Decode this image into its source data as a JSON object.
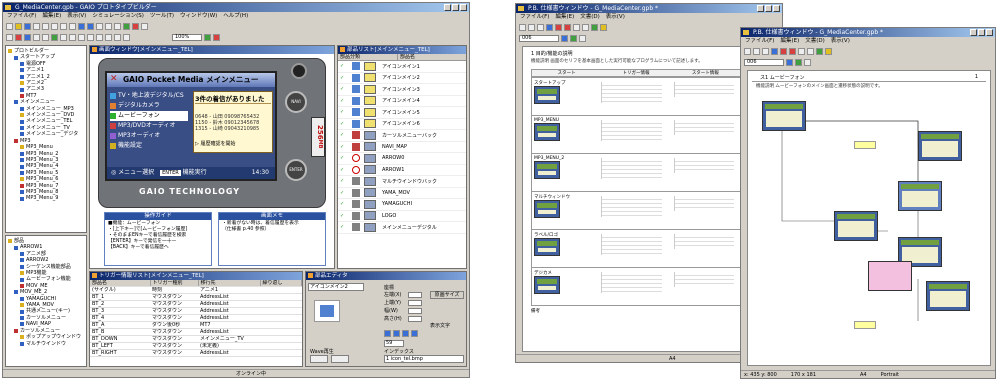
{
  "left_window": {
    "title": "G_MediaCenter.gpb - GAIO プロトタイプビルダー",
    "menu": [
      "ファイル(F)",
      "編集(E)",
      "表示(V)",
      "シミュレーション(S)",
      "ツール(T)",
      "ウィンドウ(W)",
      "ヘルプ(H)"
    ],
    "zoom": "100%",
    "status": "オンライン中",
    "tree_top": {
      "title": "プロトビルダー",
      "items": [
        "プロトビルダー",
        "スタートアップ",
        "電源OFF",
        "アニメ1",
        "アニメ1_2",
        "アニメ2",
        "アニメ3",
        "MT7",
        "メインメニュー",
        "メインメニュー_MP3",
        "メインメニュー_DVD",
        "メインメニュー_TEL",
        "メインメニュー_TV",
        "メインメニュー_デジタ",
        "MP3",
        "MP3_Menu",
        "MP3_Menu_2",
        "MP3_Menu_3",
        "MP3_Menu_4",
        "MP3_Menu_5",
        "MP3_Menu_6",
        "MP3_Menu_7",
        "MP3_Menu_8",
        "MP3_Menu_9"
      ]
    },
    "tree_bottom": {
      "title": "プロトビルダー",
      "items": [
        "部品",
        "ARROW1",
        "アニメ部",
        "ARROW2",
        "シーケンス機能部品",
        "MP3機能",
        "ムービーフォン機能",
        "MOV_ME",
        "MOV_ME_2",
        "YAMAGUCHI",
        "YAMA_MOV",
        "共通メニュー(キー)",
        "カーソルメニュー",
        "NAVI_MAP",
        "カーソルメニュー",
        "ポップアップウインドウ",
        "マルチウインドウ"
      ]
    },
    "screen_window": {
      "title": "画面ウィンドウ[メインメニュー_TEL]",
      "banner": "GAIO Pocket Media メインメニュー",
      "menu_items": [
        "TV・地上波デジタル/CS",
        "デジタルカメラ",
        "ムービーフォン",
        "MP3/DVDオーディオ",
        "MP3オーディオ",
        "機能設定"
      ],
      "history_title": "3件の着信がありました",
      "history": [
        "0648 - 山田 09098765432",
        "1150 - 鈴木 09012345678",
        "1315 - 山崎 09043210985"
      ],
      "history_link": "履歴確認を開始",
      "footer_left": "メニュー選択",
      "footer_enter": "ENTER",
      "footer_mid": "機能実行",
      "time": "14:30",
      "brand": "GAIO TECHNOLOGY",
      "side_label": "256",
      "side_unit": "MB",
      "guide_title": "操作ガイド",
      "guide_lines": [
        "■機能：ムービーフォン",
        "・[上下キー]で[ムービーフォン履歴]",
        "・そのままENキーで着信履歴を検索",
        "【ENTER】キーで発信を一十ー",
        "【BACK】キーで着信履歴へ"
      ],
      "note_title": "画面メモ",
      "note_lines": [
        "・新着がない時は、着信履歴を表示",
        "（仕様書 p.40 参照）"
      ]
    },
    "parts_list": {
      "title": "部品リスト[メインメニュー_TEL]",
      "headers": [
        "部品分類",
        "部品名"
      ],
      "rows": [
        "アイコンメイン1",
        "アイコンメイン2",
        "アイコンメイン3",
        "アイコンメイン4",
        "アイコンメイン5",
        "アイコンメイン6",
        "カーソルメニューバック",
        "NAVI_MAP",
        "ARROW0",
        "ARROW1",
        "マルチウインドウバック",
        "YAMA_MOV",
        "YAMAGUCHI",
        "LOGO",
        "メインメニューデジタル"
      ]
    },
    "trigger_list": {
      "title": "トリガー情報リスト[メインメニュー_TEL]",
      "headers": [
        "部品名",
        "トリガー種別",
        "移行先",
        "繰り返し"
      ],
      "rows": [
        [
          "(サイクル)",
          "時刻",
          "アニメ1",
          ""
        ],
        [
          "BT_1",
          "マウスダウン",
          "AddressList",
          ""
        ],
        [
          "BT_2",
          "マウスダウン",
          "AddressList",
          ""
        ],
        [
          "BT_3",
          "マウスダウン",
          "AddressList",
          ""
        ],
        [
          "BT_4",
          "マウスダウン",
          "AddressList",
          ""
        ],
        [
          "BT_A",
          "ダウン後0秒",
          "MT7",
          ""
        ],
        [
          "BT_B",
          "マウスダウン",
          "AddressList",
          ""
        ],
        [
          "BT_DOWN",
          "マウスダウン",
          "メインメニュー_TV",
          ""
        ],
        [
          "BT_LEFT",
          "マウスダウン",
          "(未定義)",
          ""
        ],
        [
          "BT_RIGHT",
          "マウスダウン",
          "AddressList",
          ""
        ]
      ]
    },
    "parts_editor": {
      "title": "部品エディタ",
      "field_label": "アイコンメイン2",
      "size_label": "座標",
      "labels": [
        "左端(X)",
        "上端(Y)",
        "幅(W)",
        "高さ(H)"
      ],
      "size_btn": "原画サイズ",
      "display_label": "表示文字",
      "index_label": "インデックス",
      "index_value": "1  icon_tel.bmp",
      "value59": "59",
      "wave_label": "Wave再生"
    }
  },
  "mid_window": {
    "title": "P.B. 仕様書ウィンドウ - G_MediaCenter.gpb *",
    "menu": [
      "ファイル(F)",
      "編集(E)",
      "文書(D)",
      "表示(V)"
    ],
    "combo": "006",
    "doc_title": "1 目的/機能の説明",
    "doc_intro": "機能説明    画面のセリフを基本画面とした実行可能なプログラムについて記述します。",
    "col_headers": [
      "スタート",
      "トリガー情報",
      "スタート情報"
    ],
    "sections": [
      "スタートアップ",
      "MP3_MENU",
      "MP3_MENU_2",
      "マルチウィンドウ",
      "ラベル/ロゴ",
      "デジカメ"
    ],
    "footer_label": "備考",
    "page_no": "A4"
  },
  "right_window": {
    "title": "P.B. 仕様書ウィンドウ - G_MediaCenter.gpb *",
    "menu": [
      "ファイル(F)",
      "編集(E)",
      "文書(D)",
      "表示(V)"
    ],
    "combo": "006",
    "doc_title": "ス1 ムービーフォン",
    "doc_intro": "機能説明    ムービーフォンのメイン画面と遷移状態の説明です。",
    "page_no": "1",
    "status": [
      "x: 435 y: 800",
      "170 x 181",
      "A4",
      "Portrait"
    ]
  }
}
